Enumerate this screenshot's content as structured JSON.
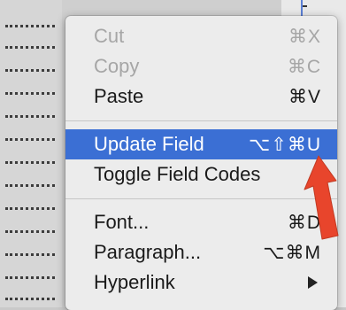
{
  "menu": {
    "cut": {
      "label": "Cut",
      "shortcut": "⌘X"
    },
    "copy": {
      "label": "Copy",
      "shortcut": "⌘C"
    },
    "paste": {
      "label": "Paste",
      "shortcut": "⌘V"
    },
    "update_field": {
      "label": "Update Field",
      "shortcut": "⌥⇧⌘U"
    },
    "toggle_field_codes": {
      "label": "Toggle Field Codes"
    },
    "font": {
      "label": "Font...",
      "shortcut": "⌘D"
    },
    "paragraph": {
      "label": "Paragraph...",
      "shortcut": "⌥⌘M"
    },
    "hyperlink": {
      "label": "Hyperlink"
    }
  },
  "colors": {
    "highlight": "#3b6fd4",
    "annotation_arrow": "#e8452c"
  },
  "icons": {
    "submenu": "chevron-right-icon",
    "annotation": "red-arrow-icon"
  }
}
